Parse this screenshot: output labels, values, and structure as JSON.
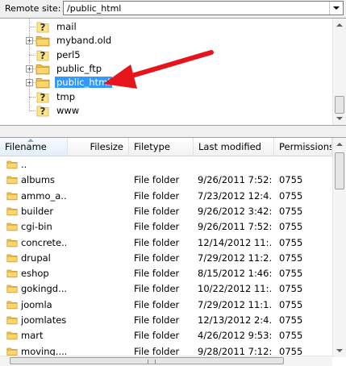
{
  "remote_site": {
    "label": "Remote site:",
    "path": "/public_html"
  },
  "tree": {
    "items": [
      {
        "name": "mail",
        "icon": "question-folder-icon",
        "expandable": false
      },
      {
        "name": "myband.old",
        "icon": "folder-icon",
        "expandable": true
      },
      {
        "name": "perl5",
        "icon": "question-folder-icon",
        "expandable": false
      },
      {
        "name": "public_ftp",
        "icon": "folder-icon",
        "expandable": true
      },
      {
        "name": "public_html",
        "icon": "folder-icon",
        "expandable": true,
        "selected": true
      },
      {
        "name": "tmp",
        "icon": "question-folder-icon",
        "expandable": false
      },
      {
        "name": "www",
        "icon": "question-folder-icon",
        "expandable": false
      }
    ],
    "annotation": "red-arrow-pointing-to-public_html"
  },
  "list": {
    "columns": [
      "Filename",
      "Filesize",
      "Filetype",
      "Last modified",
      "Permissions"
    ],
    "sorted_column": "Filename",
    "rows": [
      {
        "name": "..",
        "size": "",
        "type": "",
        "modified": "",
        "perms": ""
      },
      {
        "name": "albums",
        "size": "",
        "type": "File folder",
        "modified": "9/26/2011 7:52:...",
        "perms": "0755"
      },
      {
        "name": "ammo_a...",
        "size": "",
        "type": "File folder",
        "modified": "7/23/2012 12:4...",
        "perms": "0755"
      },
      {
        "name": "builder",
        "size": "",
        "type": "File folder",
        "modified": "9/26/2012 3:42:...",
        "perms": "0755"
      },
      {
        "name": "cgi-bin",
        "size": "",
        "type": "File folder",
        "modified": "9/26/2011 7:52:...",
        "perms": "0755"
      },
      {
        "name": "concrete...",
        "size": "",
        "type": "File folder",
        "modified": "12/14/2012 11:...",
        "perms": "0755"
      },
      {
        "name": "drupal",
        "size": "",
        "type": "File folder",
        "modified": "7/29/2012 11:2...",
        "perms": "0755"
      },
      {
        "name": "eshop",
        "size": "",
        "type": "File folder",
        "modified": "8/15/2012 1:46:...",
        "perms": "0755"
      },
      {
        "name": "gokingd...",
        "size": "",
        "type": "File folder",
        "modified": "10/22/2012 11:...",
        "perms": "0755"
      },
      {
        "name": "joomla",
        "size": "",
        "type": "File folder",
        "modified": "7/29/2012 11:1...",
        "perms": "0755"
      },
      {
        "name": "joomlatest",
        "size": "",
        "type": "File folder",
        "modified": "12/13/2012 2:4...",
        "perms": "0755"
      },
      {
        "name": "mart",
        "size": "",
        "type": "File folder",
        "modified": "4/26/2012 9:53:...",
        "perms": "0755"
      },
      {
        "name": "moving....",
        "size": "",
        "type": "File folder",
        "modified": "9/28/2011 7:12:...",
        "perms": "0755"
      }
    ]
  },
  "colors": {
    "selection": "#3399ff",
    "annotation_arrow": "#e8141c",
    "folder": "#f2c14e"
  }
}
